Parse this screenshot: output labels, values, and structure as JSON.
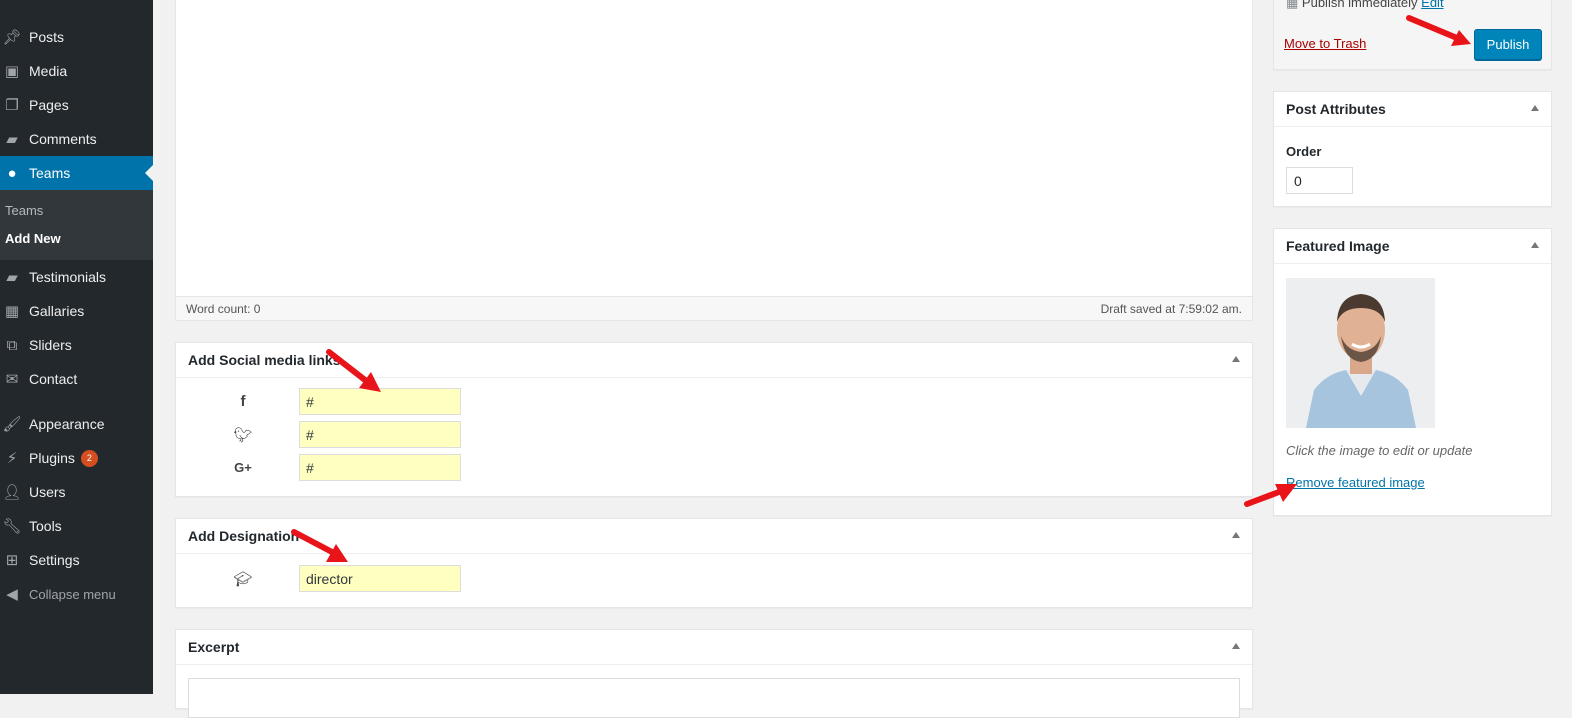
{
  "sidebar": {
    "items": [
      {
        "label": "Posts",
        "icon": "pushpin-icon"
      },
      {
        "label": "Media",
        "icon": "media-icon"
      },
      {
        "label": "Pages",
        "icon": "pages-icon"
      },
      {
        "label": "Comments",
        "icon": "comment-icon"
      },
      {
        "label": "Teams",
        "icon": "groups-icon",
        "active": true
      },
      {
        "label": "Testimonials",
        "icon": "testimonial-icon"
      },
      {
        "label": "Gallaries",
        "icon": "gallery-icon"
      },
      {
        "label": "Sliders",
        "icon": "slides-icon"
      },
      {
        "label": "Contact",
        "icon": "email-icon"
      },
      {
        "label": "Appearance",
        "icon": "paintbrush-icon"
      },
      {
        "label": "Plugins",
        "icon": "plugin-icon",
        "badge": "2"
      },
      {
        "label": "Users",
        "icon": "users-icon"
      },
      {
        "label": "Tools",
        "icon": "wrench-icon"
      },
      {
        "label": "Settings",
        "icon": "settings-icon"
      }
    ],
    "submenu": [
      {
        "label": "Teams"
      },
      {
        "label": "Add New",
        "current": true
      }
    ],
    "collapse_label": "Collapse menu"
  },
  "editor": {
    "word_count": "Word count: 0",
    "draft_status": "Draft saved at 7:59:02 am."
  },
  "social_box": {
    "title": "Add Social media links",
    "fields": [
      {
        "icon": "facebook-icon",
        "value": "#"
      },
      {
        "icon": "twitter-icon",
        "value": "#"
      },
      {
        "icon": "google-plus-icon",
        "value": "#"
      }
    ]
  },
  "designation_box": {
    "title": "Add Designation",
    "icon": "graduation-cap-icon",
    "value": "director"
  },
  "excerpt_box": {
    "title": "Excerpt"
  },
  "publish_box": {
    "publish_text": "Publish immediately",
    "edit_label": "Edit",
    "trash_label": "Move to Trash",
    "publish_label": "Publish"
  },
  "attributes_box": {
    "title": "Post Attributes",
    "order_label": "Order",
    "order_value": "0"
  },
  "featured_box": {
    "title": "Featured Image",
    "hint": "Click the image to edit or update",
    "remove_label": "Remove featured image"
  },
  "colors": {
    "accent": "#0073aa",
    "publish": "#0085ba",
    "input_highlight": "#ffffc0",
    "sidebar_bg": "#23282d",
    "arrow": "#e8141a"
  }
}
